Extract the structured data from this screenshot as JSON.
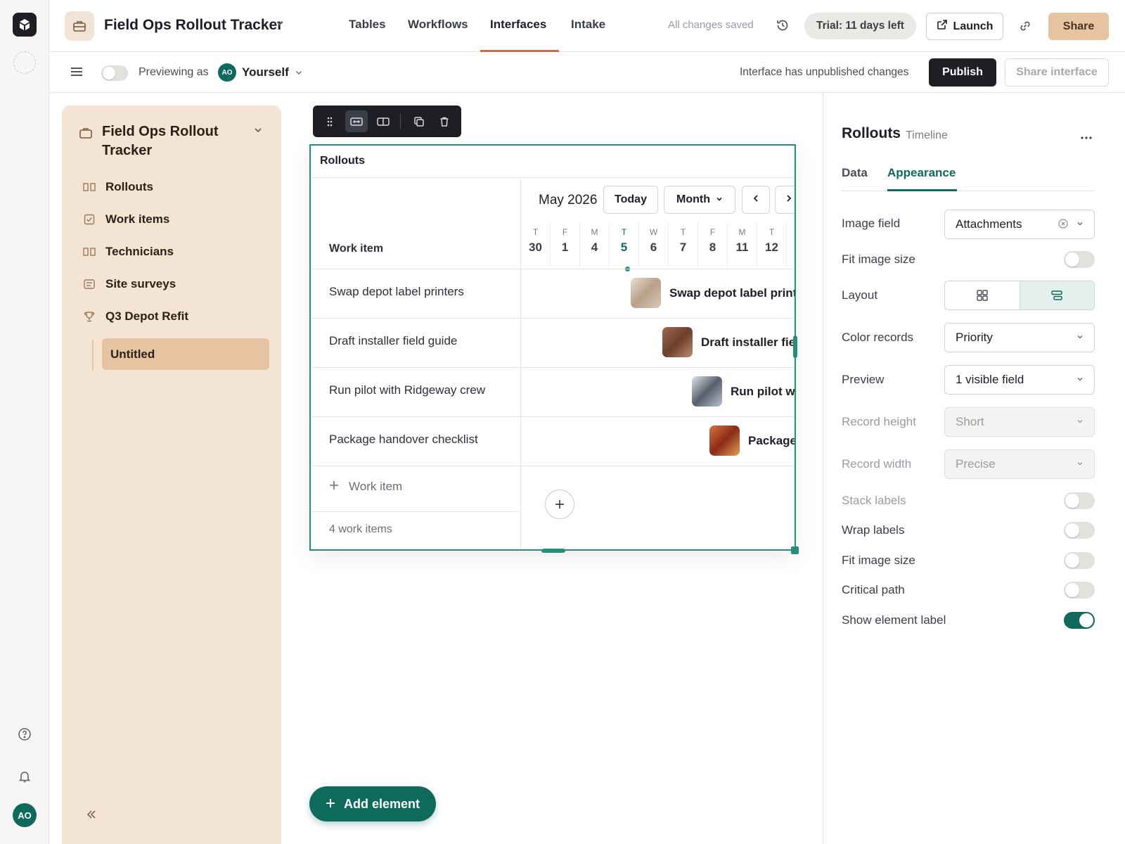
{
  "topbar": {
    "base_name": "Field Ops Rollout Tracker",
    "tabs": [
      "Tables",
      "Workflows",
      "Interfaces",
      "Intake"
    ],
    "active_tab": "Interfaces",
    "saved_status": "All changes saved",
    "trial": "Trial: 11 days left",
    "launch_label": "Launch",
    "share_label": "Share"
  },
  "subbar": {
    "previewing_label": "Previewing as",
    "avatar_initials": "AO",
    "preview_user": "Yourself",
    "unpublished_text": "Interface has unpublished changes",
    "publish_label": "Publish",
    "share_interface_label": "Share interface"
  },
  "sidebar": {
    "title": "Field Ops Rollout Tracker",
    "items": [
      {
        "label": "Rollouts",
        "icon": "grid-columns-icon"
      },
      {
        "label": "Work items",
        "icon": "checkbox-icon"
      },
      {
        "label": "Technicians",
        "icon": "grid-columns-icon"
      },
      {
        "label": "Site surveys",
        "icon": "form-icon"
      },
      {
        "label": "Q3 Depot Refit",
        "icon": "trophy-icon"
      }
    ],
    "selected_page": "Untitled"
  },
  "rail": {
    "avatar_initials": "AO"
  },
  "timeline": {
    "title": "Rollouts",
    "column_header": "Work item",
    "month_label": "May 2026",
    "today_label": "Today",
    "scale_label": "Month",
    "days": [
      {
        "dow": "T",
        "num": "30"
      },
      {
        "dow": "F",
        "num": "1"
      },
      {
        "dow": "M",
        "num": "4"
      },
      {
        "dow": "T",
        "num": "5",
        "today": true
      },
      {
        "dow": "W",
        "num": "6"
      },
      {
        "dow": "T",
        "num": "7"
      },
      {
        "dow": "F",
        "num": "8"
      },
      {
        "dow": "M",
        "num": "11"
      },
      {
        "dow": "T",
        "num": "12"
      }
    ],
    "rows": [
      {
        "label": "Swap depot label printers",
        "bar": "Swap depot label printers",
        "thumb_color": "#c9b8a6"
      },
      {
        "label": "Draft installer field guide",
        "bar": "Draft installer field guide",
        "thumb_color": "#8a5a44"
      },
      {
        "label": "Run pilot with Ridgeway crew",
        "bar": "Run pilot with Ridgeway crew",
        "thumb_color": "#6f7b8a"
      },
      {
        "label": "Package handover checklist",
        "bar": "Package handover checklist",
        "thumb_color": "#b0452a"
      }
    ],
    "add_row_label": "Work item",
    "count_label": "4 work items"
  },
  "add_element_label": "Add element",
  "panel": {
    "title": "Rollouts",
    "subtitle": "Timeline",
    "tabs": [
      "Data",
      "Appearance"
    ],
    "active_tab": "Appearance",
    "image_field_label": "Image field",
    "image_field_value": "Attachments",
    "fit_image_label": "Fit image size",
    "layout_label": "Layout",
    "color_records_label": "Color records",
    "color_records_value": "Priority",
    "preview_label": "Preview",
    "preview_value": "1 visible field",
    "record_height_label": "Record height",
    "record_height_value": "Short",
    "record_width_label": "Record width",
    "record_width_value": "Precise",
    "stack_labels_label": "Stack labels",
    "wrap_labels_label": "Wrap labels",
    "fit_image_label_2": "Fit image size",
    "critical_path_label": "Critical path",
    "show_element_label": "Show element label"
  },
  "colors": {
    "accent": "#0e6b5c",
    "selection": "#23907a",
    "brand_tan": "#e7c4a1",
    "sidebar_bg": "#f4e4d4"
  }
}
